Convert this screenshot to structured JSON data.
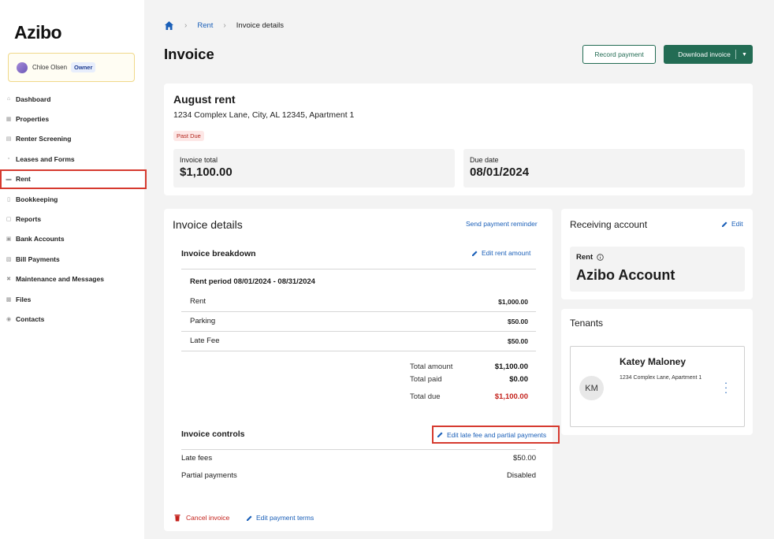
{
  "brand": {
    "logo": "Azibo"
  },
  "user": {
    "name": "Chloe Olsen",
    "role": "Owner"
  },
  "sidebar": {
    "items": [
      {
        "label": "Dashboard",
        "icon": "home-icon"
      },
      {
        "label": "Properties",
        "icon": "building-icon"
      },
      {
        "label": "Renter Screening",
        "icon": "screening-icon"
      },
      {
        "label": "Leases and Forms",
        "icon": "document-icon"
      },
      {
        "label": "Rent",
        "icon": "rent-icon",
        "active": true
      },
      {
        "label": "Bookkeeping",
        "icon": "book-icon"
      },
      {
        "label": "Reports",
        "icon": "report-icon"
      },
      {
        "label": "Bank Accounts",
        "icon": "bank-icon"
      },
      {
        "label": "Bill Payments",
        "icon": "bill-icon"
      },
      {
        "label": "Maintenance and Messages",
        "icon": "tools-icon"
      },
      {
        "label": "Files",
        "icon": "folder-icon"
      },
      {
        "label": "Contacts",
        "icon": "contacts-icon"
      }
    ]
  },
  "breadcrumb": {
    "link": "Rent",
    "current": "Invoice details"
  },
  "header": {
    "title": "Invoice",
    "record_payment": "Record payment",
    "download_invoice": "Download invoice"
  },
  "summary": {
    "title": "August rent",
    "address": "1234 Complex Lane, City, AL 12345, Apartment 1",
    "status": "Past Due",
    "total_label": "Invoice total",
    "total_value": "$1,100.00",
    "due_label": "Due date",
    "due_value": "08/01/2024"
  },
  "details": {
    "title": "Invoice details",
    "send_reminder": "Send payment reminder",
    "breakdown_title": "Invoice breakdown",
    "edit_rent": "Edit rent amount",
    "rent_period": "Rent period 08/01/2024 - 08/31/2024",
    "lines": [
      {
        "label": "Rent",
        "amount": "$1,000.00"
      },
      {
        "label": "Parking",
        "amount": "$50.00"
      },
      {
        "label": "Late Fee",
        "amount": "$50.00"
      }
    ],
    "totals": {
      "amount_label": "Total amount",
      "amount_value": "$1,100.00",
      "paid_label": "Total paid",
      "paid_value": "$0.00",
      "due_label": "Total due",
      "due_value": "$1,100.00"
    },
    "controls_title": "Invoice controls",
    "edit_late_fee": "Edit late fee and partial payments",
    "late_fees_label": "Late fees",
    "late_fees_value": "$50.00",
    "partial_label": "Partial payments",
    "partial_value": "Disabled",
    "cancel_invoice": "Cancel invoice",
    "edit_terms": "Edit payment terms"
  },
  "receiving": {
    "title": "Receiving account",
    "edit": "Edit",
    "label": "Rent",
    "account": "Azibo Account"
  },
  "tenants": {
    "title": "Tenants",
    "initials": "KM",
    "name": "Katey Maloney",
    "address": "1234 Complex Lane, Apartment 1"
  },
  "colors": {
    "primary_green": "#236c54",
    "link_blue": "#1a5fb8",
    "danger_red": "#c4221c",
    "highlight": "#d63a2f"
  }
}
